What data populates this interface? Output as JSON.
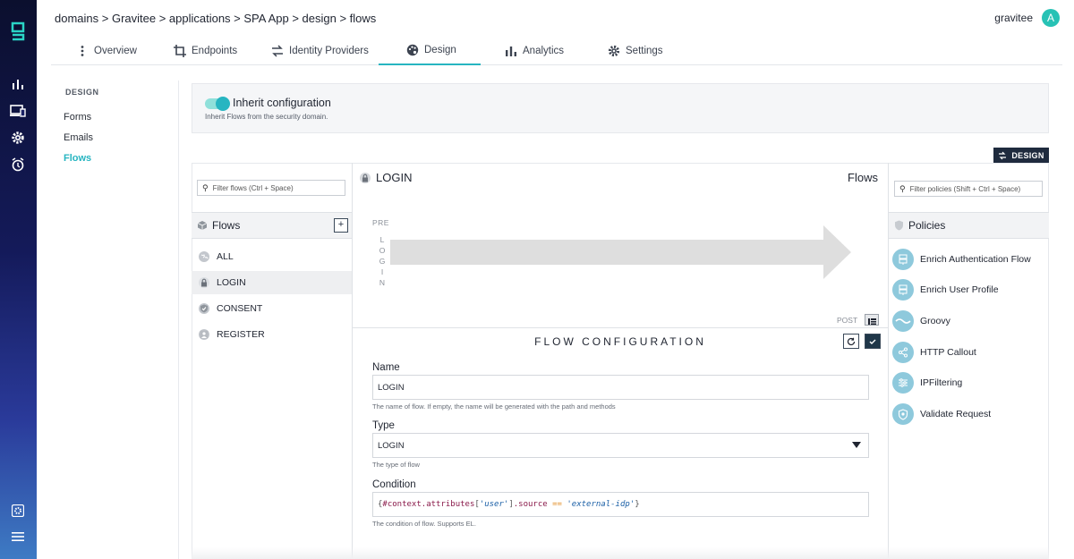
{
  "breadcrumb": "domains > Gravitee > applications > SPA App > design > flows",
  "user": {
    "name": "gravitee",
    "initial": "A"
  },
  "tabs": [
    {
      "label": "Overview",
      "icon": "more-vert-icon"
    },
    {
      "label": "Endpoints",
      "icon": "crop-icon"
    },
    {
      "label": "Identity Providers",
      "icon": "swap-icon"
    },
    {
      "label": "Design",
      "icon": "palette-icon",
      "active": true
    },
    {
      "label": "Analytics",
      "icon": "bar-chart-icon"
    },
    {
      "label": "Settings",
      "icon": "gear-icon"
    }
  ],
  "side_nav": {
    "heading": "DESIGN",
    "items": [
      {
        "label": "Forms"
      },
      {
        "label": "Emails"
      },
      {
        "label": "Flows",
        "active": true
      }
    ]
  },
  "inherit": {
    "title": "Inherit configuration",
    "subtitle": "Inherit Flows from the security domain.",
    "enabled": true
  },
  "design_button": "DESIGN",
  "flows_panel": {
    "filter_placeholder": "Filter flows (Ctrl + Space)",
    "title": "Flows",
    "items": [
      {
        "label": "ALL"
      },
      {
        "label": "LOGIN",
        "selected": true
      },
      {
        "label": "CONSENT"
      },
      {
        "label": "REGISTER"
      }
    ]
  },
  "canvas": {
    "title": "LOGIN",
    "flows_label": "Flows",
    "pre_label": "PRE",
    "vertical_label": [
      "L",
      "O",
      "G",
      "I",
      "N"
    ],
    "post_label": "POST"
  },
  "flow_config": {
    "title": "FLOW CONFIGURATION",
    "name_label": "Name",
    "name_value": "LOGIN",
    "name_hint": "The name of flow. If empty, the name will be generated with the path and methods",
    "type_label": "Type",
    "type_value": "LOGIN",
    "type_hint": "The type of flow",
    "condition_label": "Condition",
    "condition_parts": {
      "open": "{",
      "expr": "#context.attributes",
      "bracket_open": "[",
      "key": "'user'",
      "bracket_close": "]",
      "prop": ".source",
      "op": "==",
      "value": "'external-idp'",
      "close": "}"
    },
    "condition_hint": "The condition of flow. Supports EL."
  },
  "policies_panel": {
    "filter_placeholder": "Filter policies (Shift + Ctrl + Space)",
    "title": "Policies",
    "items": [
      {
        "label": "Enrich Authentication Flow",
        "icon": "storage-icon"
      },
      {
        "label": "Enrich User Profile",
        "icon": "storage-icon"
      },
      {
        "label": "Groovy",
        "icon": "groovy-icon"
      },
      {
        "label": "HTTP Callout",
        "icon": "share-icon"
      },
      {
        "label": "IPFiltering",
        "icon": "sliders-icon"
      },
      {
        "label": "Validate Request",
        "icon": "shield-icon"
      }
    ]
  },
  "colors": {
    "accent": "#27b5c1",
    "rail_top": "#0b0f2e",
    "rail_bottom": "#3e7bc4",
    "dark_button": "#1f2b3e"
  }
}
